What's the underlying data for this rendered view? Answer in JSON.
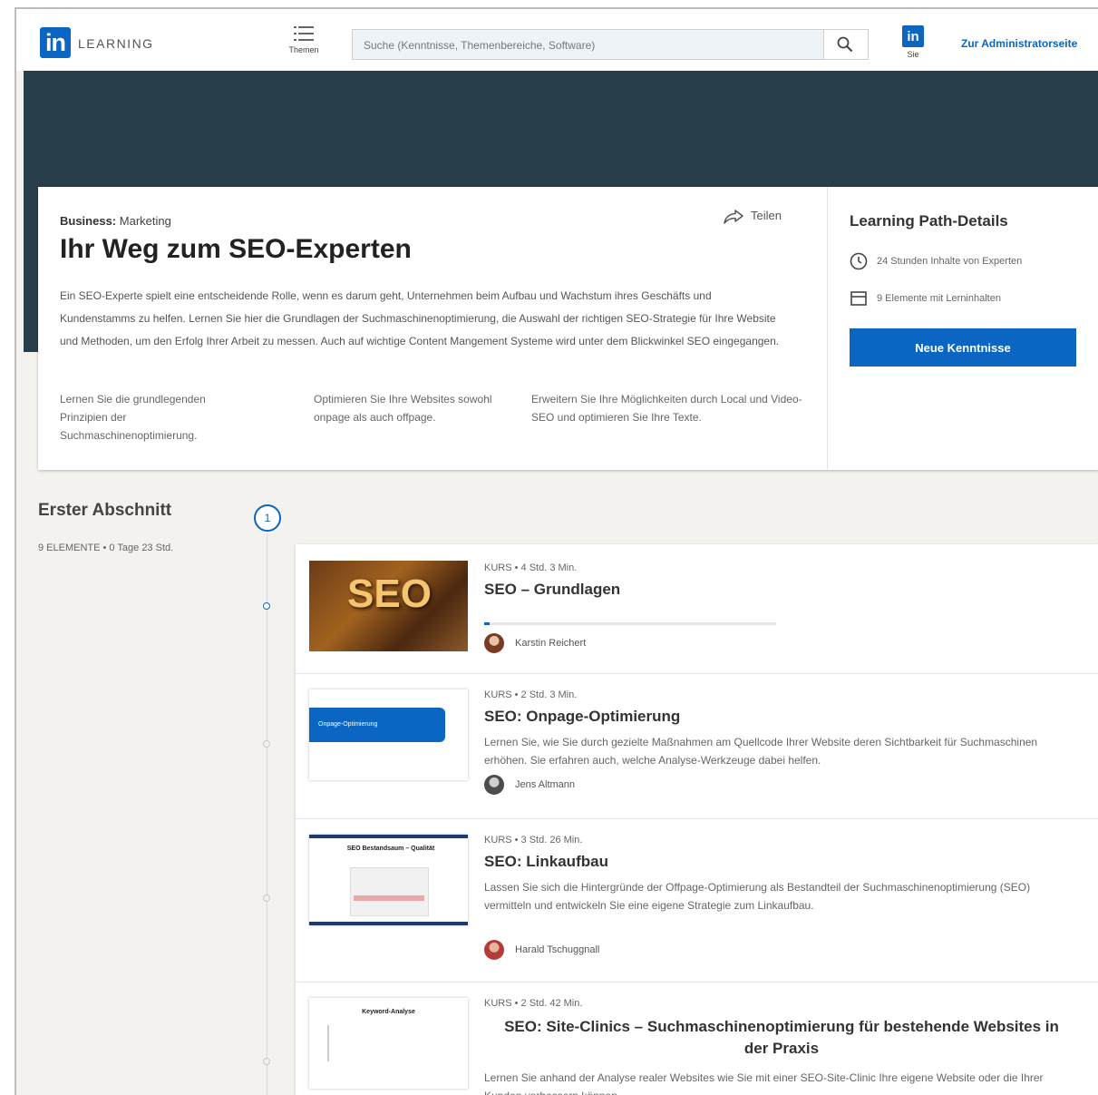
{
  "nav": {
    "logo_mark": "in",
    "logo_text": "LEARNING",
    "themen_label": "Themen",
    "search_placeholder": "Suche (Kenntnisse, Themenbereiche, Software)",
    "me_label": "Sie",
    "me_mark": "in",
    "admin_link": "Zur Administratorseite"
  },
  "path": {
    "breadcrumb_category": "Business:",
    "breadcrumb_topic": "Marketing",
    "share_label": "Teilen",
    "title": "Ihr Weg zum SEO-Experten",
    "description": "Ein SEO-Experte spielt eine entscheidende Rolle, wenn es darum geht, Unternehmen beim Aufbau und Wachstum ihres Geschäfts und Kundenstamms zu helfen. Lernen Sie hier die Grundlagen der Suchmaschinenoptimierung, die Auswahl der richtigen SEO-Strategie für Ihre Website und Methoden, um den Erfolg Ihrer Arbeit zu messen. Auch auf wichtige Content Mangement Systeme wird unter dem Blickwinkel SEO eingegangen.",
    "objectives": [
      "Lernen Sie die grundlegenden Prinzipien der Suchmaschinenoptimierung.",
      "Optimieren Sie Ihre Websites sowohl onpage als auch offpage.",
      "Erweitern Sie Ihre Möglichkeiten durch Local und Video-SEO und optimieren Sie Ihre Texte."
    ]
  },
  "details": {
    "title": "Learning Path-Details",
    "hours": "24 Stunden Inhalte von Experten",
    "elements": "9 Elemente mit Lerninhalten",
    "cta": "Neue Kenntnisse"
  },
  "section": {
    "title": "Erster Abschnitt",
    "meta": "9 ELEMENTE • 0 Tage 23 Std.",
    "step_number": "1"
  },
  "courses": [
    {
      "meta": "KURS • 4 Std. 3 Min.",
      "title": "SEO – Grundlagen",
      "description": "",
      "author": "Karstin Reichert",
      "thumb_text": "SEO",
      "progress": 0.02
    },
    {
      "meta": "KURS • 2 Std. 3 Min.",
      "title": "SEO: Onpage-Optimierung",
      "description": "Lernen Sie, wie Sie durch gezielte Maßnahmen am Quellcode Ihrer Website deren Sichtbarkeit für Suchmaschinen erhöhen. Sie erfahren auch, welche Analyse-Werkzeuge dabei helfen.",
      "author": "Jens Altmann",
      "thumb_text": "Onpage-Optimierung"
    },
    {
      "meta": "KURS • 3 Std. 26 Min.",
      "title": "SEO: Linkaufbau",
      "description": "Lassen Sie sich die Hintergründe der Offpage-Optimierung als Bestandteil der Suchmaschinenoptimierung (SEO) vermitteln und entwickeln Sie eine eigene Strategie zum Linkaufbau.",
      "author": "Harald Tschuggnall",
      "thumb_text": "SEO Bestandsaum – Qualität"
    },
    {
      "meta": "KURS • 2 Std. 42 Min.",
      "title": "SEO: Site-Clinics – Suchmaschinenoptimierung für bestehende Websites in der Praxis",
      "description": "Lernen Sie anhand der Analyse realer Websites wie Sie mit einer SEO-Site-Clinic Ihre eigene Website oder die Ihrer Kunden verbessern können.",
      "author": "",
      "thumb_text": "Keyword-Analyse"
    }
  ],
  "colors": {
    "brand": "#0a66c2",
    "hero": "#283e4a"
  }
}
